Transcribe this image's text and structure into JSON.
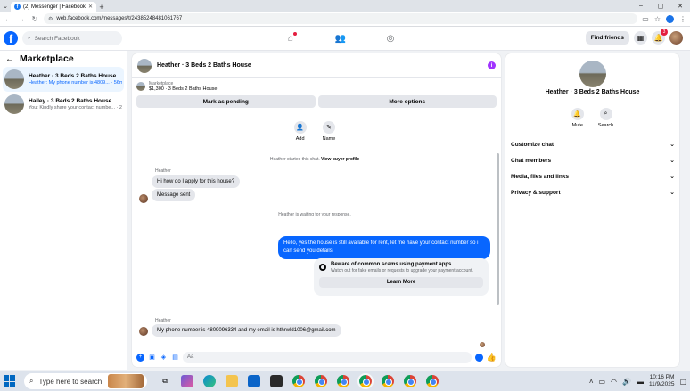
{
  "browser": {
    "tab_title": "(2) Messenger | Facebook",
    "url": "web.facebook.com/messages/t/24385248481061767"
  },
  "fb": {
    "search_placeholder": "Search Facebook",
    "find_friends": "Find friends",
    "notifications_badge": "3",
    "messenger_badge": "1"
  },
  "sidebar": {
    "title": "Marketplace",
    "conversations": [
      {
        "name": "Heather · 3 Beds 2 Baths House",
        "snippet": "Heather: My phone number is 4809...",
        "time": "56m"
      },
      {
        "name": "Hailey · 3 Beds 2 Baths House",
        "snippet": "You: Kindly share your contact numbe...",
        "time": "2h"
      }
    ]
  },
  "chat": {
    "title": "Heather · 3 Beds 2 Baths House",
    "marketplace_label": "Marketplace",
    "listing": "$1,300 · 3 Beds 2 Baths House",
    "mark_pending": "Mark as pending",
    "more_options": "More options",
    "add_label": "Add",
    "name_label": "Name",
    "started_text": "Heather started this chat.",
    "view_profile": "View buyer profile",
    "sender1": "Heather",
    "msg1": "Hi how do I apply for this house?",
    "msg2": "Message sent",
    "waiting_text": "Heather is waiting for your response.",
    "out_msg_line1": "Hello, yes the house is still available for rent, let me have your contact number so i",
    "out_msg_line2": "can send you  details",
    "scam_title": "Beware of common scams using payment apps",
    "scam_sub": "Watch out for fake emails or requests to upgrade your payment account.",
    "learn_more": "Learn More",
    "sender2": "Heather",
    "msg3": "My phone number is 4809096334 and my email is hthrwld1006@gmail.com",
    "composer_placeholder": "Aa"
  },
  "details": {
    "name": "Heather · 3 Beds 2 Baths House",
    "mute": "Mute",
    "search": "Search",
    "sections": [
      "Customize chat",
      "Chat members",
      "Media, files and links",
      "Privacy & support"
    ]
  },
  "taskbar": {
    "search_placeholder": "Type here to search",
    "time": "10:16 PM",
    "date": "11/9/2025"
  },
  "colors": {
    "accent": "#0866ff",
    "outgoing_bubble": "#0866ff",
    "incoming_bubble": "#e4e6eb"
  }
}
